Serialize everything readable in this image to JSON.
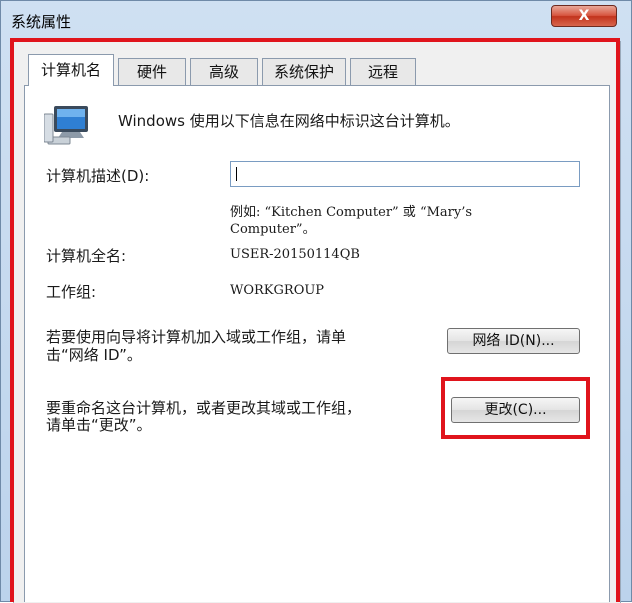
{
  "window": {
    "title": "系统属性",
    "close_label": "X"
  },
  "tabs": [
    {
      "label": "计算机名"
    },
    {
      "label": "硬件"
    },
    {
      "label": "高级"
    },
    {
      "label": "系统保护"
    },
    {
      "label": "远程"
    }
  ],
  "info": {
    "text": "Windows 使用以下信息在网络中标识这台计算机。"
  },
  "description": {
    "label": "计算机描述(D):",
    "value": "",
    "example_line1": "例如: “Kitchen Computer” 或 “Mary’s",
    "example_line2": "Computer”。"
  },
  "full_name": {
    "label": "计算机全名:",
    "value": "USER-20150114QB"
  },
  "workgroup": {
    "label": "工作组:",
    "value": "WORKGROUP"
  },
  "network_id": {
    "text_line1": "若要使用向导将计算机加入域或工作组，请单",
    "text_line2": "击“网络 ID”。",
    "button_label": "网络 ID(N)..."
  },
  "change": {
    "text_line1": "要重命名这台计算机，或者更改其域或工作组，",
    "text_line2": "请单击“更改”。",
    "button_label": "更改(C)..."
  },
  "colors": {
    "highlight": "#e0141c",
    "title_bg": "#c9dbef",
    "close_btn": "#c9442f"
  },
  "icons": {
    "computer": "computer-icon",
    "close": "close-icon"
  }
}
